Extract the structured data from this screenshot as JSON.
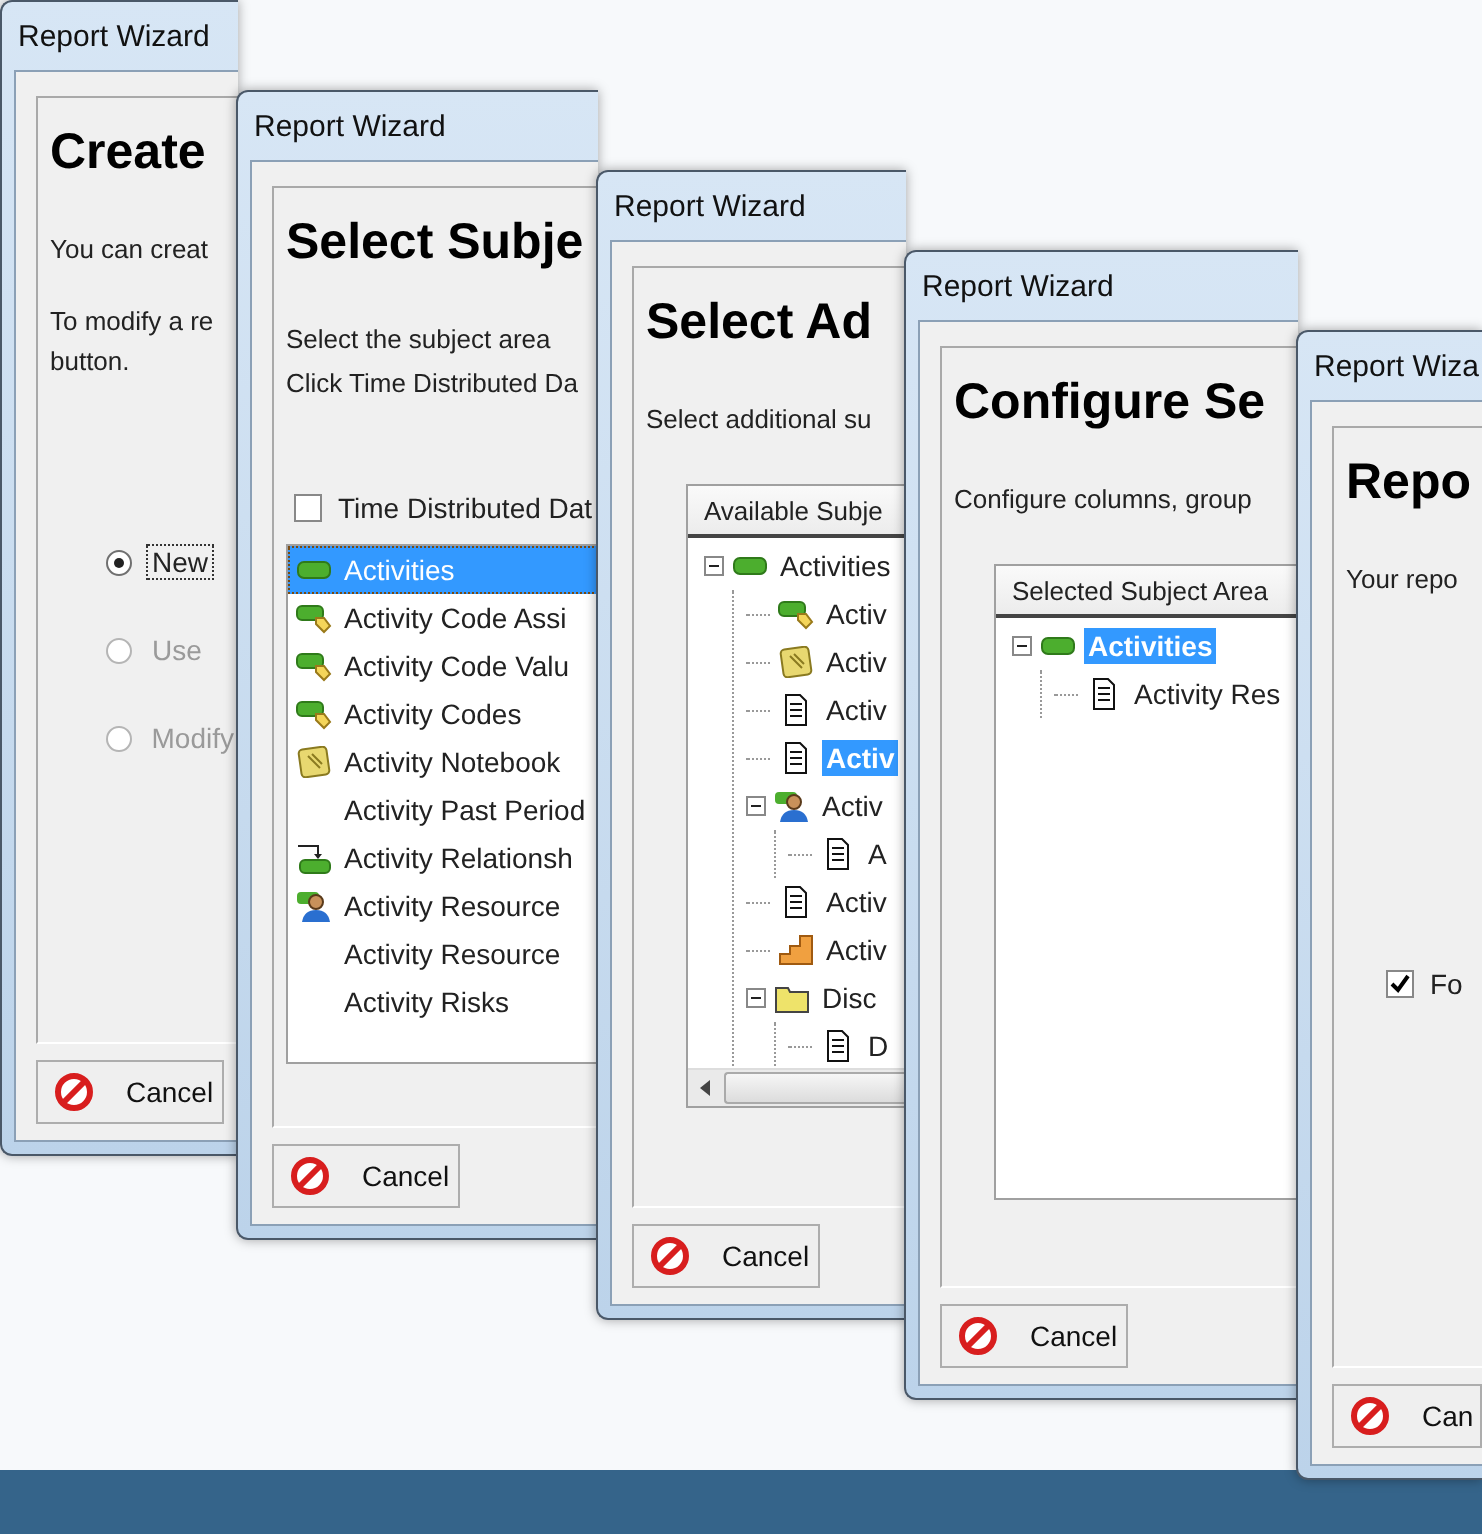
{
  "windows": [
    {
      "kind": "start",
      "title": "Report Wizard",
      "heading": "Create",
      "paragraphs": [
        "You can creat",
        "To modify a re",
        "button."
      ],
      "options": [
        {
          "label": "New",
          "selected": true,
          "disabled": false
        },
        {
          "label": "Use",
          "selected": false,
          "disabled": true
        },
        {
          "label": "Modify",
          "selected": false,
          "disabled": true
        }
      ],
      "cancel": "Cancel"
    },
    {
      "kind": "subjects",
      "title": "Report Wizard",
      "heading": "Select Subje",
      "paragraphs": [
        "Select the subject area",
        "Click Time Distributed Da"
      ],
      "checkbox": {
        "label": "Time Distributed Dat",
        "checked": false
      },
      "items": [
        {
          "label": "Activities",
          "kind": "bar",
          "selected": true
        },
        {
          "label": "Activity Code Assi",
          "kind": "tag",
          "selected": false
        },
        {
          "label": "Activity Code Valu",
          "kind": "tag",
          "selected": false
        },
        {
          "label": "Activity Codes",
          "kind": "tag",
          "selected": false
        },
        {
          "label": "Activity Notebook",
          "kind": "notebook",
          "selected": false
        },
        {
          "label": "Activity Past Period",
          "kind": "plain",
          "selected": false
        },
        {
          "label": "Activity Relationsh",
          "kind": "link",
          "selected": false
        },
        {
          "label": "Activity Resource",
          "kind": "person",
          "selected": false
        },
        {
          "label": "Activity Resource",
          "kind": "plain",
          "selected": false
        },
        {
          "label": "Activity Risks",
          "kind": "plain",
          "selected": false
        }
      ],
      "cancel": "Cancel"
    },
    {
      "kind": "additional",
      "title": "Report Wizard",
      "heading": "Select Ad",
      "paragraphs": [
        "Select additional su"
      ],
      "column_header": "Available Subje",
      "tree": [
        {
          "label": "Activities",
          "kind": "bar",
          "selected": false,
          "expanded": true,
          "children": [
            {
              "label": "Activ",
              "kind": "tag",
              "selected": false
            },
            {
              "label": "Activ",
              "kind": "notebook",
              "selected": false
            },
            {
              "label": "Activ",
              "kind": "doc",
              "selected": false
            },
            {
              "label": "Activ",
              "kind": "doc",
              "selected": true
            },
            {
              "label": "Activ",
              "kind": "person",
              "selected": false,
              "expanded": true,
              "children": [
                {
                  "label": "A",
                  "kind": "doc",
                  "selected": false
                }
              ]
            },
            {
              "label": "Activ",
              "kind": "doc",
              "selected": false
            },
            {
              "label": "Activ",
              "kind": "steps",
              "selected": false
            },
            {
              "label": "Disc",
              "kind": "folder",
              "selected": false,
              "expanded": true,
              "children": [
                {
                  "label": "D",
                  "kind": "doc",
                  "selected": false
                }
              ]
            }
          ]
        }
      ],
      "cancel": "Cancel"
    },
    {
      "kind": "configure",
      "title": "Report Wizard",
      "heading": "Configure Se",
      "paragraphs": [
        "Configure columns, group"
      ],
      "column_header": "Selected Subject Area",
      "tree": [
        {
          "label": "Activities",
          "kind": "bar",
          "selected": true,
          "expanded": true,
          "children": [
            {
              "label": "Activity Res",
              "kind": "doc",
              "selected": false
            }
          ]
        }
      ],
      "cancel": "Cancel"
    },
    {
      "kind": "finish",
      "title": "Report Wiza",
      "heading": "Repo",
      "paragraphs": [
        "Your repo"
      ],
      "checkbox": {
        "label": "Fo",
        "checked": true
      },
      "cancel": "Can"
    }
  ]
}
